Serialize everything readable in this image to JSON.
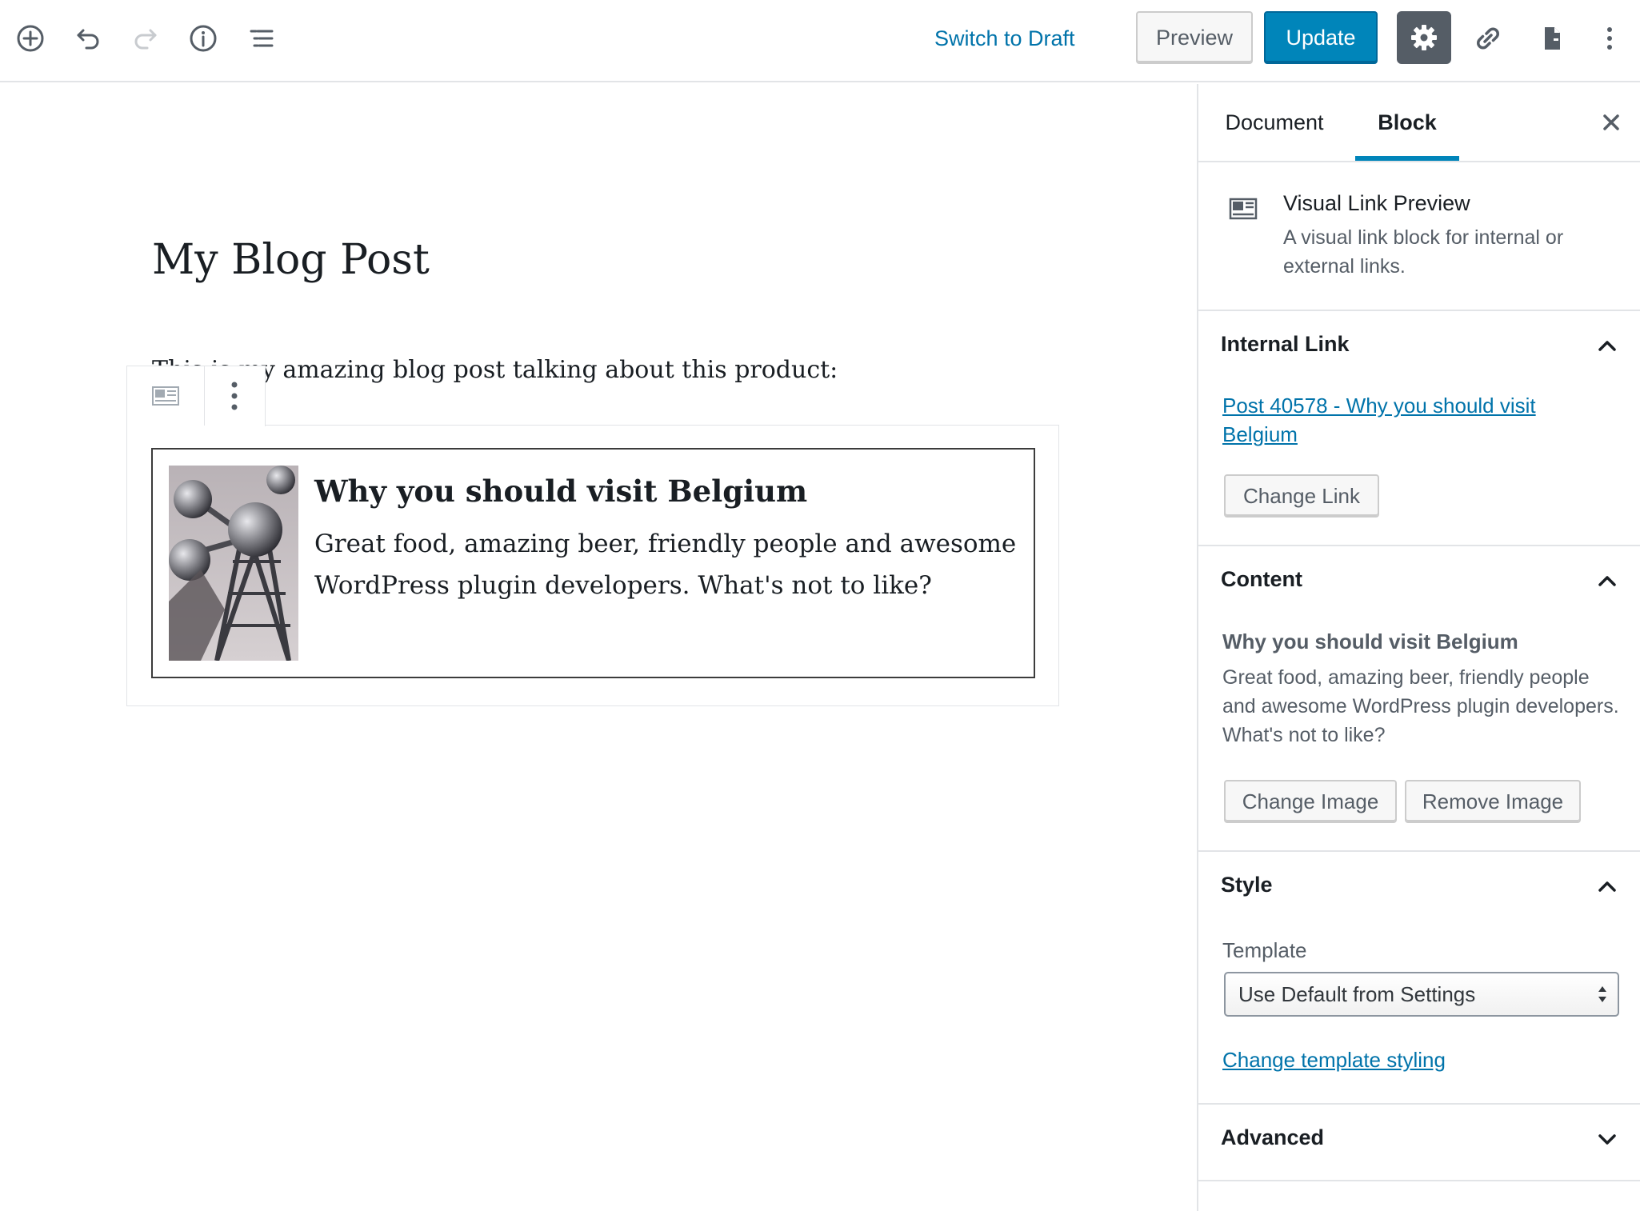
{
  "toolbar": {
    "switch_to_draft": "Switch to Draft",
    "preview": "Preview",
    "update": "Update",
    "accent": "#0085ba"
  },
  "editor": {
    "post_title": "My Blog Post",
    "paragraph": "This is my amazing blog post talking about this product:",
    "visual_link": {
      "title": "Why you should visit Belgium",
      "description": "Great food, amazing beer, friendly people and awesome WordPress plugin developers. What's not to like?"
    }
  },
  "sidebar": {
    "tabs": [
      {
        "label": "Document",
        "active": false
      },
      {
        "label": "Block",
        "active": true
      }
    ],
    "block_card": {
      "title": "Visual Link Preview",
      "description": "A visual link block for internal or external links."
    },
    "internal_link": {
      "header": "Internal Link",
      "link_text": "Post 40578 - Why you should visit Belgium",
      "change_button": "Change Link"
    },
    "content": {
      "header": "Content",
      "title": "Why you should visit Belgium",
      "description": "Great food, amazing beer, friendly people and awesome WordPress plugin developers. What's not to like?",
      "change_image": "Change Image",
      "remove_image": "Remove Image"
    },
    "style": {
      "header": "Style",
      "template_label": "Template",
      "template_value": "Use Default from Settings",
      "styling_link": "Change template styling"
    },
    "advanced": {
      "header": "Advanced"
    }
  }
}
